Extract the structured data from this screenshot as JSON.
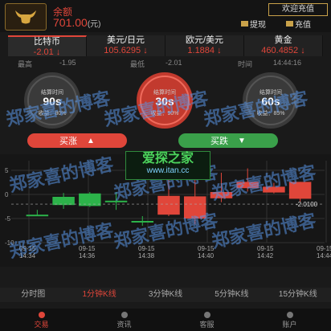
{
  "header": {
    "balance_label": "余额",
    "balance_value": "701.00",
    "balance_unit": "(元)",
    "welcome_label": "欢迎充值",
    "withdraw_label": "提现",
    "recharge_label": "充值"
  },
  "tickers": [
    {
      "name": "比特币",
      "value": "-2.01 ↓"
    },
    {
      "name": "美元/日元",
      "value": "105.6295 ↓"
    },
    {
      "name": "欧元/美元",
      "value": "1.1884 ↓"
    },
    {
      "name": "黄金",
      "value": "460.4852 ↓"
    }
  ],
  "stats": {
    "high_label": "最高",
    "high_value": "-1.95",
    "low_label": "最低",
    "low_value": "-2.01",
    "time_label": "时间",
    "time_value": "14:44:16"
  },
  "dials": [
    {
      "label": "结算时间",
      "value": "90s",
      "payout": "收益：80%"
    },
    {
      "label": "结算时间",
      "value": "30s",
      "payout": "收益：90%"
    },
    {
      "label": "结算时间",
      "value": "60s",
      "payout": "收益：85%"
    }
  ],
  "actions": {
    "rise_label": "买涨",
    "fall_label": "买跌"
  },
  "chart_data": {
    "type": "candlestick",
    "y_ticks": [
      "5",
      "0",
      "-5",
      "-10"
    ],
    "ylim": [
      -10,
      7
    ],
    "x_ticks": [
      {
        "date": "09-15",
        "time": "14:34"
      },
      {
        "date": "09-15",
        "time": "14:36"
      },
      {
        "date": "09-15",
        "time": "14:38"
      },
      {
        "date": "09-15",
        "time": "14:40"
      },
      {
        "date": "09-15",
        "time": "14:42"
      },
      {
        "date": "09-15",
        "time": "14:44"
      }
    ],
    "last_price_label": "-2.0100",
    "colors": {
      "up": "#e0463a",
      "down": "#2cb34a",
      "grid": "#333333"
    },
    "candles": [
      {
        "open": -4.2,
        "close": -4.2,
        "high": -3.2,
        "low": -4.5
      },
      {
        "open": -2.2,
        "close": -0.5,
        "high": 0.3,
        "low": -3.0
      },
      {
        "open": -2.4,
        "close": 0.2,
        "high": 0.5,
        "low": -2.6
      },
      {
        "open": -1.3,
        "close": -1.3,
        "high": 0.5,
        "low": -3.2
      },
      {
        "open": -5.5,
        "close": -5.5,
        "high": -4.5,
        "low": -6.5
      },
      {
        "open": -0.3,
        "close": -4.2,
        "high": 3.5,
        "low": -4.5
      },
      {
        "open": -0.4,
        "close": -5.0,
        "high": 3.6,
        "low": -6.2
      },
      {
        "open": 0.5,
        "close": -0.8,
        "high": 4.5,
        "low": -1.6
      },
      {
        "open": 2.6,
        "close": 1.3,
        "high": 5.4,
        "low": 0.6
      },
      {
        "open": 1.6,
        "close": 0.4,
        "high": 2.4,
        "low": 0.2
      },
      {
        "open": 2.6,
        "close": -0.9,
        "high": 2.6,
        "low": -1.5
      }
    ]
  },
  "ktabs": [
    "分时图",
    "1分钟K线",
    "3分钟K线",
    "5分钟K线",
    "15分钟K线"
  ],
  "nav": [
    "交易",
    "资讯",
    "客服",
    "账户"
  ],
  "overlay": {
    "watermark": "郑家喜的博客",
    "site_title": "爱探之家",
    "site_url": "www.itan.cc"
  }
}
